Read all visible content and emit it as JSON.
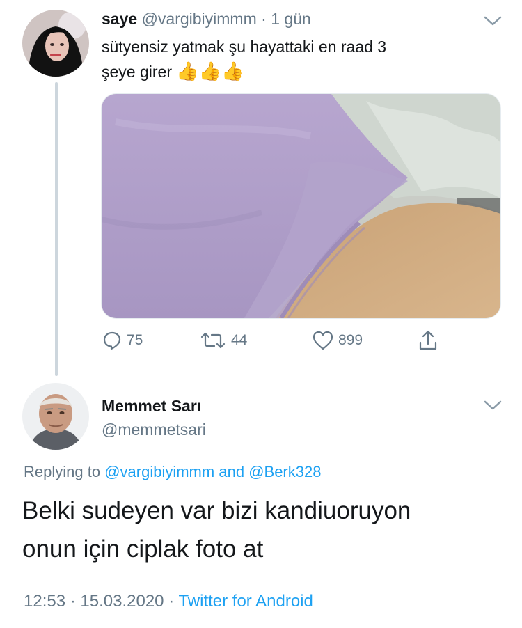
{
  "tweet": {
    "display_name": "saye",
    "handle": "@vargibiyimmm",
    "separator": "·",
    "time": "1 gün",
    "text_line1": "sütyensiz yatmak şu hayattaki en raad 3",
    "text_line2": "şeye girer",
    "emoji": "👍👍👍",
    "actions": {
      "replies": "75",
      "retweets": "44",
      "likes": "899"
    }
  },
  "reply": {
    "display_name": "Memmet Sarı",
    "handle": "@memmetsari",
    "replying_prefix": "Replying to",
    "replying_user1": "@vargibiyimmm",
    "replying_and": "and",
    "replying_user2": "@Berk328",
    "text_line1": "Belki sudeyen var bizi kandiuoruyon",
    "text_line2": "onun için ciplak foto at",
    "time": "12:53",
    "dot1": "·",
    "date": "15.03.2020",
    "dot2": "·",
    "source": "Twitter for Android"
  },
  "colors": {
    "link": "#1da1f2",
    "muted": "#657786",
    "text": "#14171a",
    "thread_line": "#cdd6dd"
  }
}
